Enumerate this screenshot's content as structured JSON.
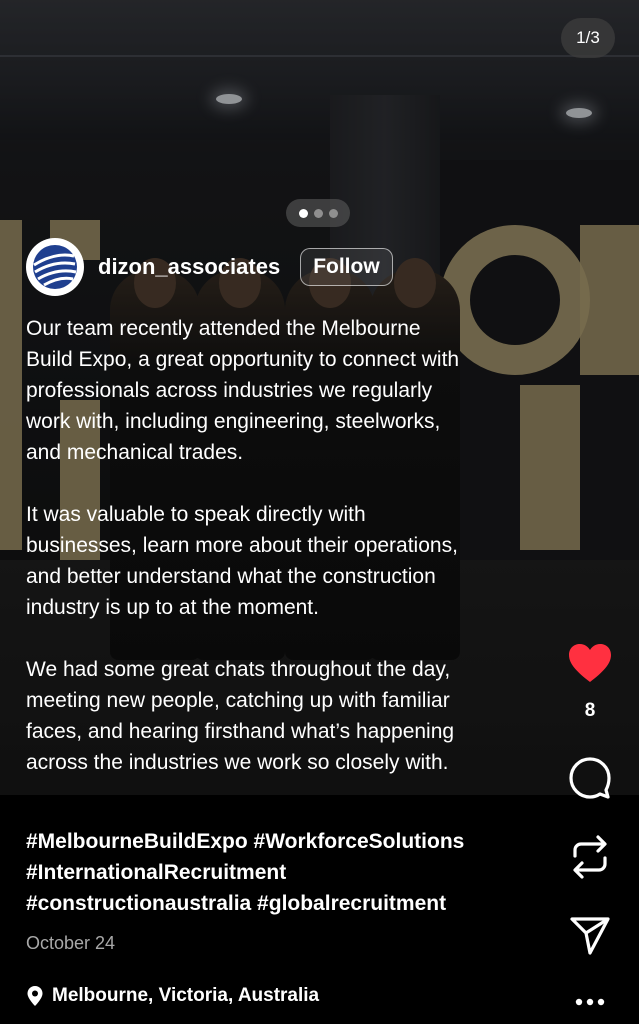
{
  "carousel": {
    "counter": "1/3",
    "total": 3,
    "active_index": 0
  },
  "author": {
    "username": "dizon_associates",
    "follow_label": "Follow"
  },
  "caption": {
    "paragraphs": [
      "Our team recently attended the Melbourne\nBuild Expo, a great opportunity to connect with\nprofessionals across industries we regularly\nwork with, including engineering, steelworks,\nand mechanical trades.",
      "It was valuable to speak directly with\nbusinesses, learn more about their operations,\nand better understand what the construction\nindustry is up to at the moment.",
      "We had some great chats throughout the day,\nmeeting new people, catching up with familiar\nfaces, and hearing firsthand what’s happening\nacross the industries we work so closely with."
    ],
    "hashtags": "#MelbourneBuildExpo #WorkforceSolutions\n#InternationalRecruitment\n#constructionaustralia #globalrecruitment"
  },
  "meta": {
    "date": "October 24",
    "location": "Melbourne, Victoria, Australia"
  },
  "actions": {
    "like_count": "8",
    "icons": [
      "heart-icon",
      "comment-icon",
      "repost-icon",
      "share-icon",
      "more-icon"
    ],
    "like_color": "#ff3040"
  }
}
